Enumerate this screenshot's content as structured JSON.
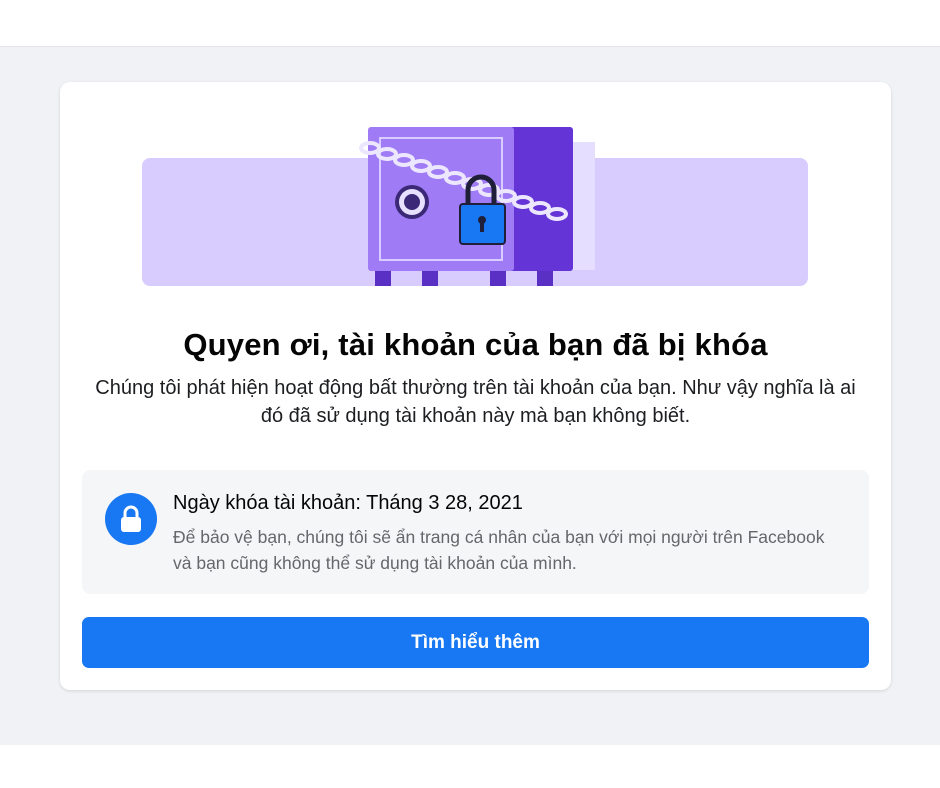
{
  "lock_notice": {
    "title": "Quyen ơi, tài khoản của bạn đã bị khóa",
    "description": "Chúng tôi phát hiện hoạt động bất thường trên tài khoản của bạn. Như vậy nghĩa là ai đó đã sử dụng tài khoản này mà bạn không biết.",
    "illustration_icon": "locked-safe-icon"
  },
  "info_box": {
    "icon": "lock-icon",
    "title": "Ngày khóa tài khoản: Tháng 3 28, 2021",
    "text": "Để bảo vệ bạn, chúng tôi sẽ ẩn trang cá nhân của bạn với mọi người trên Facebook và bạn cũng không thể sử dụng tài khoản của mình."
  },
  "actions": {
    "learn_more_label": "Tìm hiểu thêm"
  },
  "colors": {
    "accent": "#1877f2",
    "background": "#f0f2f5",
    "illustration_purple": "#6d3fd8",
    "illustration_light": "#d9ccff"
  }
}
